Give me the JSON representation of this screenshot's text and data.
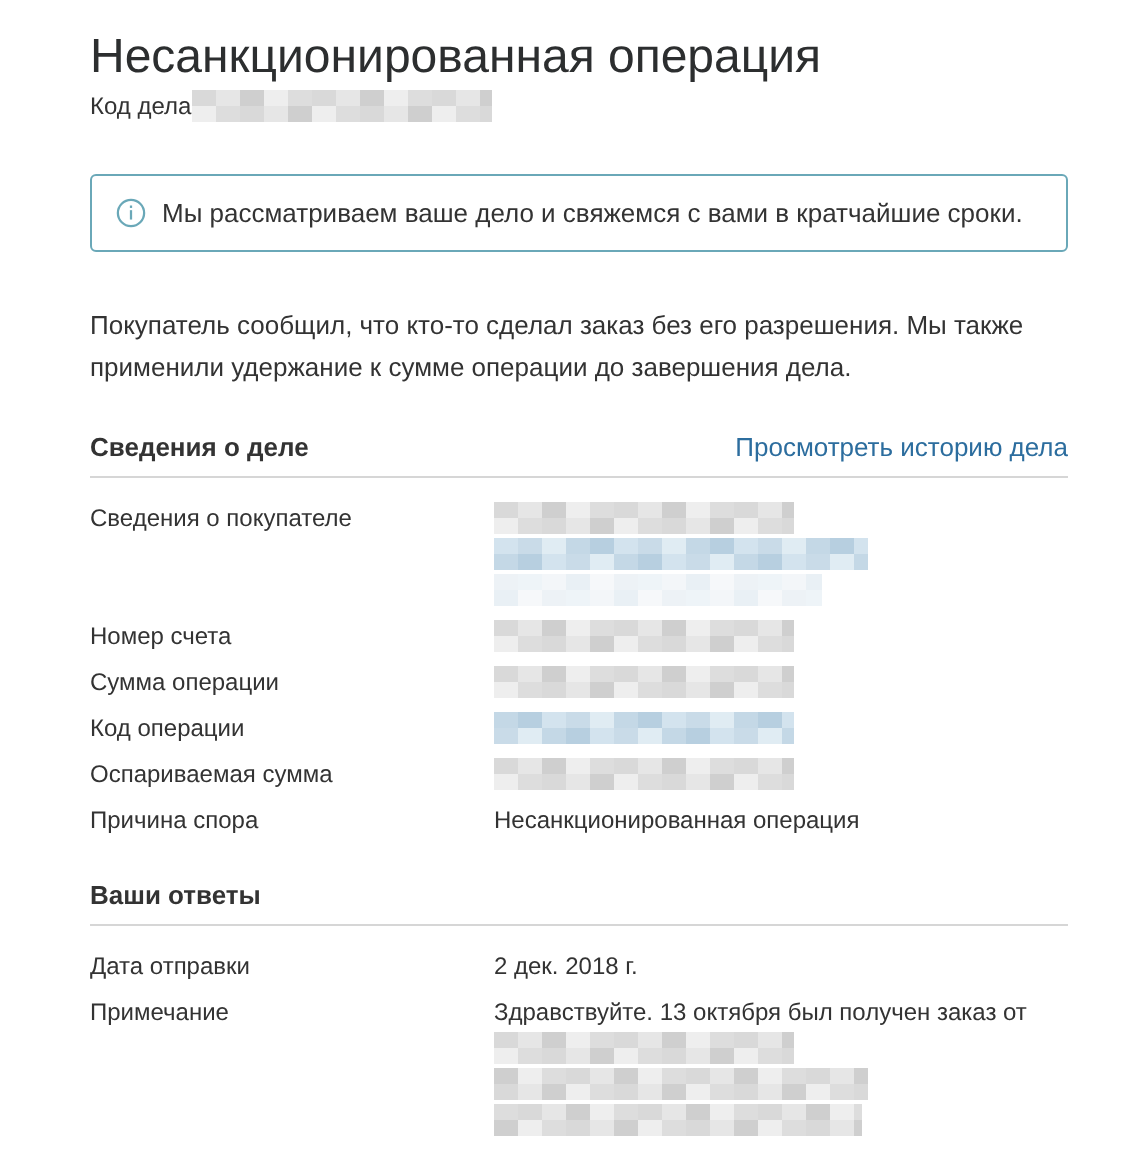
{
  "title": "Несанкционированная операция",
  "case_code": {
    "label": "Код дела",
    "redacted": [
      {
        "kind": "grey"
      }
    ]
  },
  "notice": {
    "text": "Мы рассматриваем ваше дело и свяжемся с вами в кратчайшие сроки."
  },
  "description": "Покупатель сообщил, что кто-то сделал заказ без его разрешения. Мы также применили удержание к сумме операции до завершения дела.",
  "sections": [
    {
      "heading": "Сведения о деле",
      "link": "Просмотреть историю дела",
      "rows": [
        {
          "label": "Сведения о покупателе",
          "redacted": [
            {
              "kind": "grey"
            },
            {
              "kind": "blue"
            },
            {
              "kind": "faint"
            }
          ]
        },
        {
          "label": "Номер счета",
          "redacted": [
            {
              "kind": "grey"
            }
          ]
        },
        {
          "label": "Сумма операции",
          "redacted": [
            {
              "kind": "grey"
            }
          ]
        },
        {
          "label": "Код операции",
          "redacted": [
            {
              "kind": "blue"
            }
          ]
        },
        {
          "label": "Оспариваемая сумма",
          "redacted": [
            {
              "kind": "grey"
            }
          ]
        },
        {
          "label": "Причина спора",
          "value": "Несанкционированная операция"
        }
      ]
    },
    {
      "heading": "Ваши ответы",
      "rows": [
        {
          "label": "Дата отправки",
          "value": "2 дек. 2018 г."
        },
        {
          "label": "Примечание",
          "value": "Здравствуйте. 13 октября был получен заказ от",
          "redacted": [
            {
              "kind": "grey"
            },
            {
              "kind": "grey"
            },
            {
              "kind": "grey"
            }
          ]
        }
      ]
    }
  ]
}
